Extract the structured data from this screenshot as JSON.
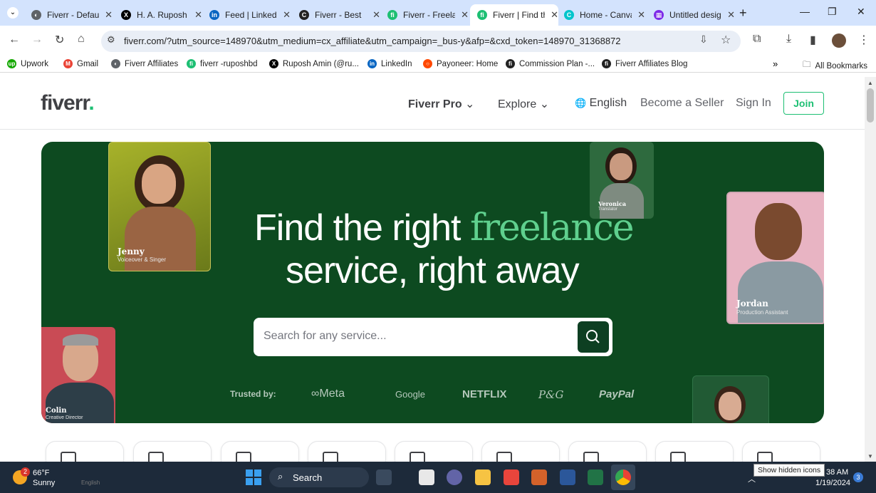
{
  "tabs": [
    {
      "title": "Fiverr - Default",
      "color": "#5f6368",
      "glyph": "◐"
    },
    {
      "title": "H. A. Ruposh",
      "color": "#000000",
      "glyph": "X"
    },
    {
      "title": "Feed | LinkedIn",
      "color": "#0a66c2",
      "glyph": "in"
    },
    {
      "title": "Fiverr - Best",
      "color": "#222222",
      "glyph": "C"
    },
    {
      "title": "Fiverr - Freelance",
      "color": "#1dbf73",
      "glyph": "fi"
    },
    {
      "title": "Fiverr | Find the",
      "color": "#1dbf73",
      "glyph": "fi"
    },
    {
      "title": "Home - Canva",
      "color": "#00c4cc",
      "glyph": "C"
    },
    {
      "title": "Untitled design",
      "color": "#7d2ae8",
      "glyph": "▦"
    }
  ],
  "browser": {
    "url": "fiverr.com/?utm_source=148970&utm_medium=cx_affiliate&utm_campaign=_bus-y&afp=&cxd_token=148970_31368872"
  },
  "bookmarks": [
    {
      "label": "Upwork",
      "color": "#14a800",
      "glyph": "up"
    },
    {
      "label": "Gmail",
      "color": "#ea4335",
      "glyph": "M"
    },
    {
      "label": "Fiverr Affiliates",
      "color": "#5f6368",
      "glyph": "◐"
    },
    {
      "label": "fiverr -ruposhbd",
      "color": "#1dbf73",
      "glyph": "fi"
    },
    {
      "label": "Ruposh Amin (@ru...",
      "color": "#000000",
      "glyph": "X"
    },
    {
      "label": "LinkedIn",
      "color": "#0a66c2",
      "glyph": "in"
    },
    {
      "label": "Payoneer: Home",
      "color": "#ff4800",
      "glyph": "○"
    },
    {
      "label": "Commission Plan -...",
      "color": "#222222",
      "glyph": "fi"
    },
    {
      "label": "Fiverr Affiliates Blog",
      "color": "#222222",
      "glyph": "fi"
    }
  ],
  "all_bookmarks": "All Bookmarks",
  "header": {
    "logo": "fiverr",
    "logo_dot": ".",
    "fiverr_pro": "Fiverr Pro",
    "explore": "Explore",
    "language": "English",
    "become_seller": "Become a Seller",
    "sign_in": "Sign In",
    "join": "Join"
  },
  "hero": {
    "line1_a": "Find the right ",
    "line1_green": "freelance",
    "line2": "service, right away",
    "search_placeholder": "Search for any service...",
    "trusted_by": "Trusted by:",
    "brands": [
      "∞Meta",
      "Google",
      "NETFLIX",
      "P&G",
      "PayPal"
    ],
    "people": [
      {
        "name": "Jenny",
        "role": "Voiceover & Singer"
      },
      {
        "name": "Veronica",
        "role": "Translator"
      },
      {
        "name": "Jordan",
        "role": "Production Assistant"
      },
      {
        "name": "Colin",
        "role": "Creative Director"
      }
    ]
  },
  "taskbar": {
    "temp": "66°F",
    "weather": "Sunny",
    "badge": "2",
    "search": "Search",
    "lang": "English",
    "time": "38 AM",
    "date": "1/19/2024",
    "notif": "3",
    "tooltip": "Show hidden icons"
  },
  "colors": {
    "brand": "#1dbf73",
    "hero_bg": "#0d4a20"
  }
}
